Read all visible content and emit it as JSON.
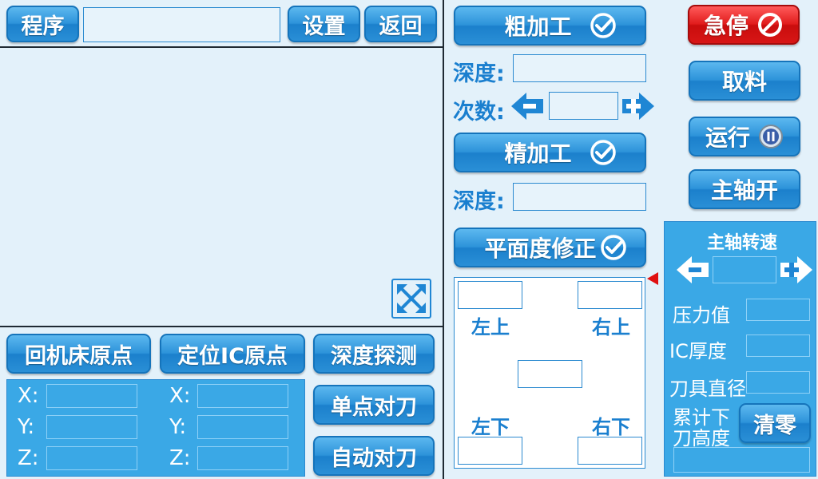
{
  "left_top": {
    "program_label": "程序",
    "settings_label": "设置",
    "back_label": "返回",
    "program_value": ""
  },
  "left_bottom": {
    "home_machine_label": "回机床原点",
    "locate_ic_label": "定位IC原点",
    "depth_probe_label": "深度探测",
    "single_tool_label": "单点对刀",
    "auto_tool_label": "自动对刀",
    "coords_left": [
      {
        "axis": "X:",
        "value": ""
      },
      {
        "axis": "Y:",
        "value": ""
      },
      {
        "axis": "Z:",
        "value": ""
      }
    ],
    "coords_right": [
      {
        "axis": "X:",
        "value": ""
      },
      {
        "axis": "Y:",
        "value": ""
      },
      {
        "axis": "Z:",
        "value": ""
      }
    ]
  },
  "middle": {
    "rough_label": "粗加工",
    "depth_label": "深度:",
    "times_label": "次数:",
    "rough_depth_value": "",
    "times_value": "",
    "fine_label": "精加工",
    "fine_depth_label": "深度:",
    "fine_depth_value": "",
    "flatness_label": "平面度修正",
    "corner_tl": "左上",
    "corner_tr": "右上",
    "corner_bl": "左下",
    "corner_br": "右下"
  },
  "right": {
    "estop_label": "急停",
    "take_label": "取料",
    "run_label": "运行",
    "spindle_on_label": "主轴开",
    "spindle_speed_title": "主轴转速",
    "spindle_speed_value": "",
    "pressure_label": "压力值",
    "ic_thickness_label": "IC厚度",
    "tool_diameter_label": "刀具直径",
    "cumulative_label_1": "累计下",
    "cumulative_label_2": "刀高度",
    "clear_label": "清零"
  },
  "colors": {
    "accent": "#2d93da",
    "background": "#e3f1fa",
    "estop": "#e11c1c",
    "indicator": "#e01010"
  }
}
